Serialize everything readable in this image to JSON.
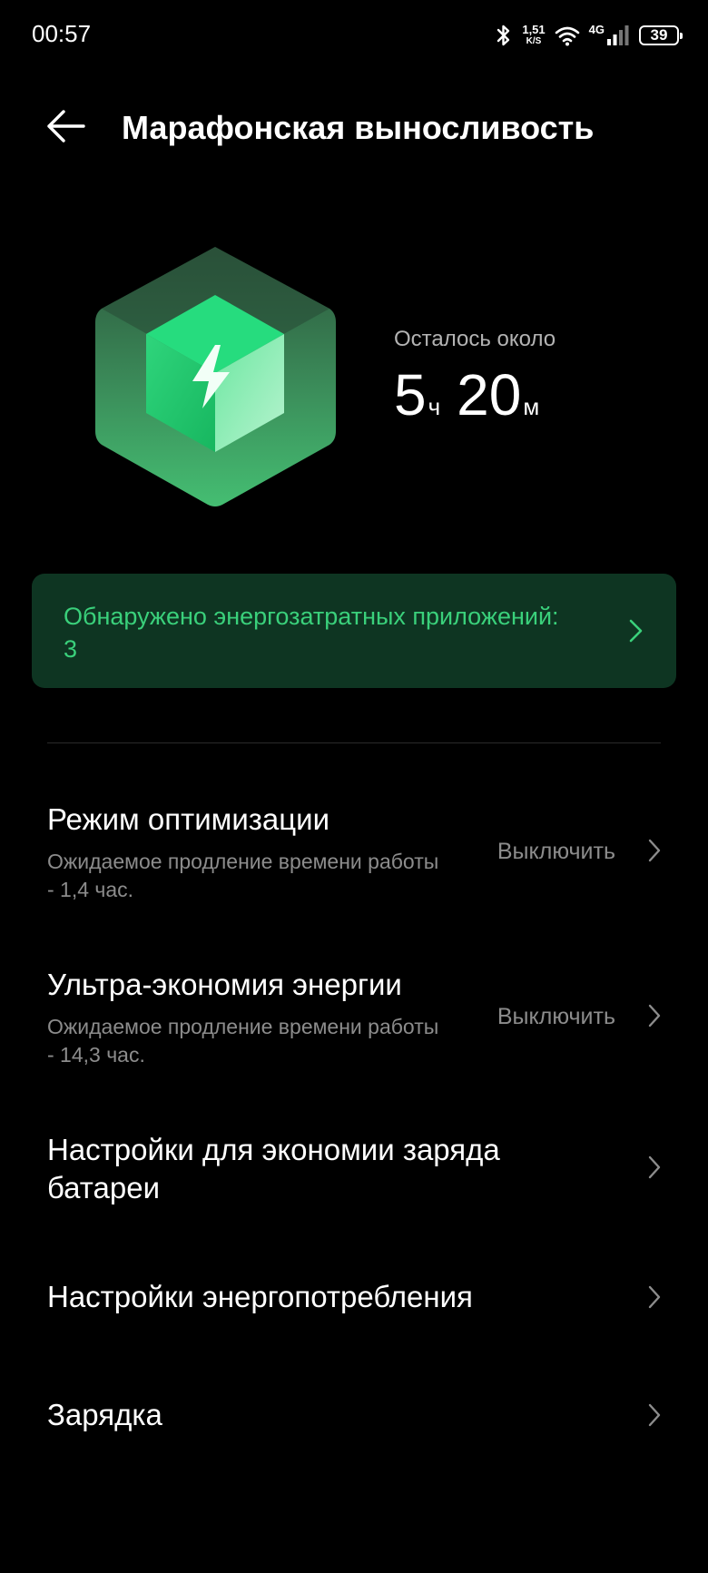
{
  "status_bar": {
    "time": "00:57",
    "net_speed_value": "1,51",
    "net_speed_unit": "K/S",
    "network_type": "4G",
    "battery_level": "39",
    "icons": [
      "bluetooth-icon",
      "wifi-icon",
      "signal-icon",
      "battery-icon"
    ]
  },
  "header": {
    "back_icon": "arrow-left-icon",
    "title": "Марафонская выносливость"
  },
  "summary": {
    "illustration": "battery-cube-icon",
    "remaining_label": "Осталось около",
    "hours_value": "5",
    "hours_unit": "ч",
    "minutes_value": "20",
    "minutes_unit": "м"
  },
  "alert": {
    "text": "Обнаружено энергозатратных приложений: 3",
    "chevron_icon": "chevron-right-icon"
  },
  "settings": [
    {
      "title": "Режим оптимизации",
      "subtitle": "Ожидаемое продление времени работы - 1,4 час.",
      "value": "Выключить"
    },
    {
      "title": "Ультра-экономия энергии",
      "subtitle": "Ожидаемое продление времени работы - 14,3 час.",
      "value": "Выключить"
    },
    {
      "title": "Настройки для экономии заряда батареи"
    },
    {
      "title": "Настройки энергопотребления"
    },
    {
      "title": "Зарядка"
    }
  ],
  "colors": {
    "background": "#000000",
    "accent_green": "#3ad07b",
    "alert_background": "#0e3522",
    "secondary_text": "#8c8c8c"
  }
}
